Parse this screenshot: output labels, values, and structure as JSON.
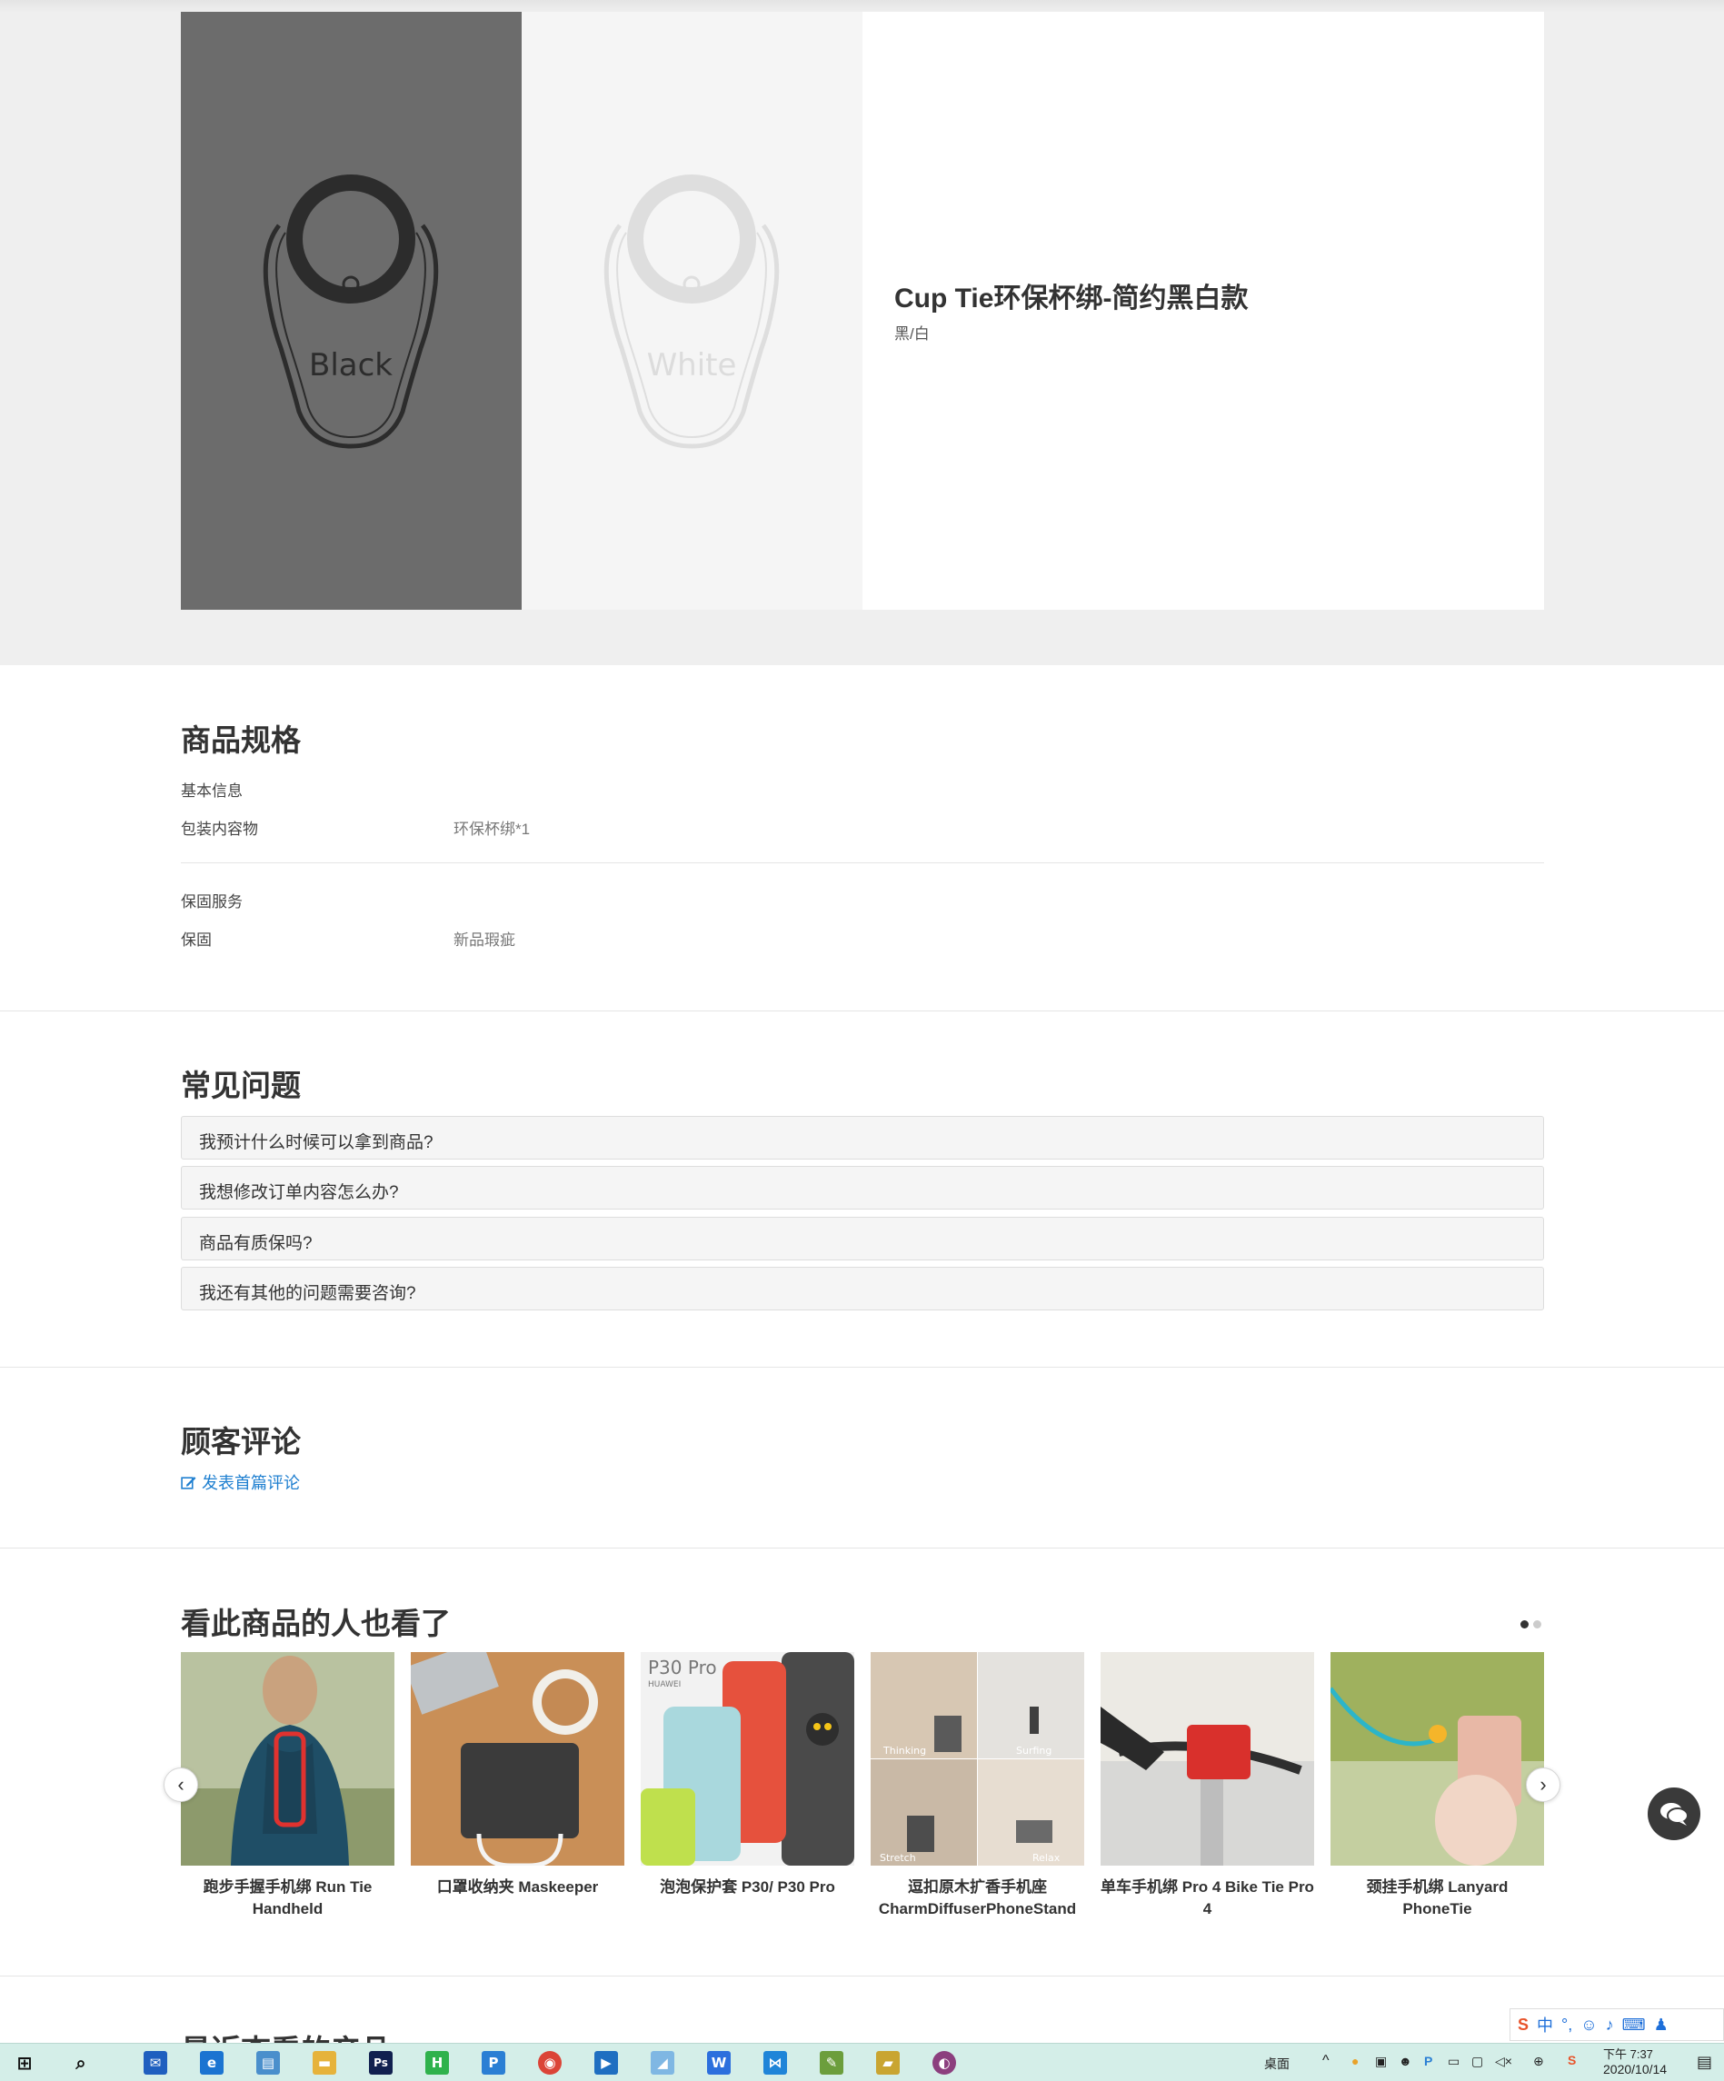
{
  "product": {
    "title": "Cup Tie环保杯绑-简约黑白款",
    "variant": "黑/白",
    "swatches": [
      {
        "name": "Black",
        "bg": "#6c6c6c",
        "stroke": "#2c2c2c"
      },
      {
        "name": "White",
        "bg": "#f5f5f5",
        "stroke": "#dedede"
      }
    ]
  },
  "specs": {
    "title": "商品规格",
    "groups": [
      {
        "heading": "基本信息",
        "rows": [
          {
            "label": "包装内容物",
            "value": "环保杯绑*1"
          }
        ]
      },
      {
        "heading": "保固服务",
        "rows": [
          {
            "label": "保固",
            "value": "新品瑕疵"
          }
        ]
      }
    ]
  },
  "faq": {
    "title": "常见问题",
    "items": [
      "我预计什么时候可以拿到商品?",
      "我想修改订单内容怎么办?",
      "商品有质保吗?",
      "我还有其他的问题需要咨询?"
    ]
  },
  "reviews": {
    "title": "顾客评论",
    "link": "发表首篇评论"
  },
  "related": {
    "title": "看此商品的人也看了",
    "items": [
      {
        "name": "跑步手握手机绑 Run Tie Handheld"
      },
      {
        "name": "口罩收纳夹 Maskeeper"
      },
      {
        "name": "泡泡保护套 P30/ P30 Pro",
        "image_text": "P30 Pro",
        "image_subtext": "HUAWEI"
      },
      {
        "name": "逗扣原木扩香手机座 CharmDiffuserPhoneStand",
        "image_text": [
          "Thinking",
          "Surfing",
          "Stretch",
          "Relax"
        ]
      },
      {
        "name": "单车手机绑 Pro 4 Bike Tie Pro 4"
      },
      {
        "name": "颈挂手机绑 Lanyard PhoneTie"
      }
    ]
  },
  "recent": {
    "title": "最近查看的产品"
  },
  "taskbar": {
    "desktop_label": "桌面",
    "time": "下午 7:37",
    "date": "2020/10/14",
    "ime_label": "中"
  }
}
